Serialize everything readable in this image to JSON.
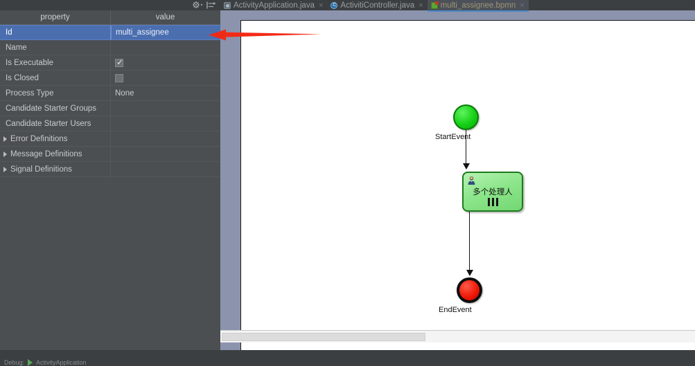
{
  "left_panel": {
    "toolbar": {
      "settings_icon": "gear-dropdown-icon",
      "collapse_icon": "collapse-all-icon"
    },
    "columns": {
      "property": "property",
      "value": "value"
    },
    "rows": [
      {
        "name": "Id",
        "value": "multi_assignee",
        "type": "text",
        "selected": true,
        "expandable": false
      },
      {
        "name": "Name",
        "value": "",
        "type": "text",
        "selected": false,
        "expandable": false
      },
      {
        "name": "Is Executable",
        "value": "",
        "type": "checkbox",
        "checked": true,
        "selected": false,
        "expandable": false
      },
      {
        "name": "Is Closed",
        "value": "",
        "type": "checkbox",
        "checked": false,
        "selected": false,
        "expandable": false
      },
      {
        "name": "Process Type",
        "value": "None",
        "type": "text",
        "selected": false,
        "expandable": false
      },
      {
        "name": "Candidate Starter Groups",
        "value": "",
        "type": "text",
        "selected": false,
        "expandable": false
      },
      {
        "name": "Candidate Starter Users",
        "value": "",
        "type": "text",
        "selected": false,
        "expandable": false
      },
      {
        "name": "Error Definitions",
        "value": "",
        "type": "text",
        "selected": false,
        "expandable": true
      },
      {
        "name": "Message Definitions",
        "value": "",
        "type": "text",
        "selected": false,
        "expandable": true
      },
      {
        "name": "Signal Definitions",
        "value": "",
        "type": "text",
        "selected": false,
        "expandable": true
      }
    ],
    "status_bar": {
      "label": "Debug:",
      "run_config": "ActivityApplication"
    }
  },
  "editor": {
    "tabs": [
      {
        "label": "ActivityApplication.java",
        "icon": "java-class-icon",
        "active": false,
        "close": "×"
      },
      {
        "label": "ActivitiController.java",
        "icon": "java-controller-icon",
        "active": false,
        "close": "×"
      },
      {
        "label": "multi_assignee.bpmn",
        "icon": "bpmn-file-icon",
        "active": true,
        "close": "×"
      }
    ],
    "diagram": {
      "start_event": {
        "label": "StartEvent",
        "color": "#16d016"
      },
      "task": {
        "label": "多个处理人",
        "color": "#8ee68c",
        "marker": "parallel-multi-instance",
        "icon": "user-task-icon"
      },
      "end_event": {
        "label": "EndEvent",
        "color": "#ef1a08"
      }
    },
    "scrollbar": {
      "name": "horizontal-scrollbar"
    }
  },
  "annotation": {
    "arrow_color": "#ff2a1a",
    "points_to": "multi_assignee"
  }
}
